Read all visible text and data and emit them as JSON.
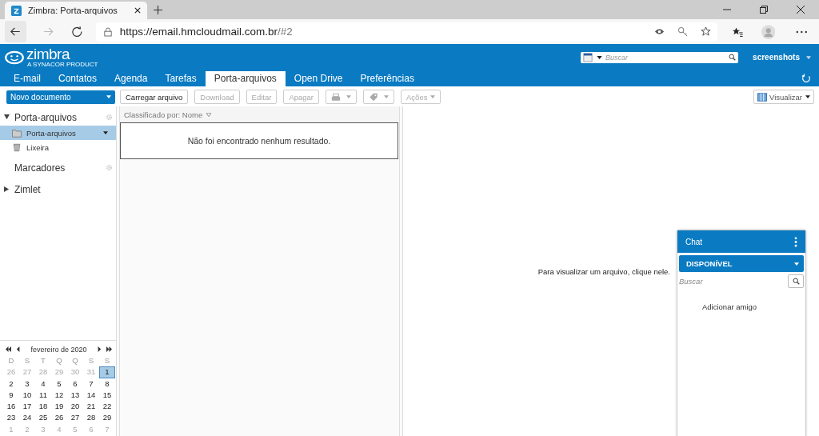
{
  "browser": {
    "tab_title": "Zimbra: Porta-arquivos",
    "url_host": "https://email.hmcloudmail.com.br",
    "url_path": "/#2"
  },
  "header": {
    "logo": "zimbra",
    "logo_tagline": "A SYNACOR PRODUCT",
    "search_placeholder": "Buscar",
    "user": "screenshots"
  },
  "nav_tabs": [
    {
      "label": "E-mail",
      "selected": false
    },
    {
      "label": "Contatos",
      "selected": false
    },
    {
      "label": "Agenda",
      "selected": false
    },
    {
      "label": "Tarefas",
      "selected": false
    },
    {
      "label": "Porta-arquivos",
      "selected": true
    },
    {
      "label": "Open Drive",
      "selected": false
    },
    {
      "label": "Preferências",
      "selected": false
    }
  ],
  "toolbar": {
    "new_button": "Novo documento",
    "items": [
      {
        "kind": "text",
        "label": "Carregar arquivo",
        "disabled": false
      },
      {
        "kind": "text",
        "label": "Download",
        "disabled": true
      },
      {
        "kind": "text",
        "label": "Editar",
        "disabled": true
      },
      {
        "kind": "text",
        "label": "Apagar",
        "disabled": true
      },
      {
        "kind": "printer",
        "disabled": true
      },
      {
        "kind": "tag",
        "disabled": true
      },
      {
        "kind": "menu",
        "label": "Ações",
        "disabled": true
      }
    ],
    "view_button": "Visualizar"
  },
  "sidebar": {
    "sections": [
      {
        "label": "Porta-arquivos",
        "kind": "tree",
        "expanded": true,
        "children": [
          {
            "label": "Porta-arquivos",
            "kind": "folder",
            "selected": true
          },
          {
            "label": "Lixeira",
            "kind": "trash",
            "selected": false
          }
        ]
      },
      {
        "label": "Marcadores",
        "kind": "plain"
      },
      {
        "label": "Zimlet",
        "kind": "tree",
        "expanded": false
      }
    ]
  },
  "file_list": {
    "sort_label": "Classificado por: Nome",
    "empty_message": "Não foi encontrado nenhum resultado."
  },
  "preview": {
    "hint": "Para visualizar um arquivo, clique nele."
  },
  "calendar": {
    "month": "fevereiro de 2020",
    "weekdays": [
      "D",
      "S",
      "T",
      "Q",
      "Q",
      "S",
      "S"
    ],
    "weeks": [
      [
        {
          "day": "26",
          "other_month": true,
          "selected": false
        },
        {
          "day": "27",
          "other_month": true,
          "selected": false
        },
        {
          "day": "28",
          "other_month": true,
          "selected": false
        },
        {
          "day": "29",
          "other_month": true,
          "selected": false
        },
        {
          "day": "30",
          "other_month": true,
          "selected": false
        },
        {
          "day": "31",
          "other_month": true,
          "selected": false
        },
        {
          "day": "1",
          "other_month": false,
          "selected": true
        }
      ],
      [
        {
          "day": "2",
          "other_month": false,
          "selected": false
        },
        {
          "day": "3",
          "other_month": false,
          "selected": false
        },
        {
          "day": "4",
          "other_month": false,
          "selected": false
        },
        {
          "day": "5",
          "other_month": false,
          "selected": false
        },
        {
          "day": "6",
          "other_month": false,
          "selected": false
        },
        {
          "day": "7",
          "other_month": false,
          "selected": false
        },
        {
          "day": "8",
          "other_month": false,
          "selected": false
        }
      ],
      [
        {
          "day": "9",
          "other_month": false,
          "selected": false
        },
        {
          "day": "10",
          "other_month": false,
          "selected": false
        },
        {
          "day": "11",
          "other_month": false,
          "selected": false
        },
        {
          "day": "12",
          "other_month": false,
          "selected": false
        },
        {
          "day": "13",
          "other_month": false,
          "selected": false
        },
        {
          "day": "14",
          "other_month": false,
          "selected": false
        },
        {
          "day": "15",
          "other_month": false,
          "selected": false
        }
      ],
      [
        {
          "day": "16",
          "other_month": false,
          "selected": false
        },
        {
          "day": "17",
          "other_month": false,
          "selected": false
        },
        {
          "day": "18",
          "other_month": false,
          "selected": false
        },
        {
          "day": "19",
          "other_month": false,
          "selected": false
        },
        {
          "day": "20",
          "other_month": false,
          "selected": false
        },
        {
          "day": "21",
          "other_month": false,
          "selected": false
        },
        {
          "day": "22",
          "other_month": false,
          "selected": false
        }
      ],
      [
        {
          "day": "23",
          "other_month": false,
          "selected": false
        },
        {
          "day": "24",
          "other_month": false,
          "selected": false
        },
        {
          "day": "25",
          "other_month": false,
          "selected": false
        },
        {
          "day": "26",
          "other_month": false,
          "selected": false
        },
        {
          "day": "27",
          "other_month": false,
          "selected": false
        },
        {
          "day": "28",
          "other_month": false,
          "selected": false
        },
        {
          "day": "29",
          "other_month": false,
          "selected": false
        }
      ],
      [
        {
          "day": "1",
          "other_month": true,
          "selected": false
        },
        {
          "day": "2",
          "other_month": true,
          "selected": false
        },
        {
          "day": "3",
          "other_month": true,
          "selected": false
        },
        {
          "day": "4",
          "other_month": true,
          "selected": false
        },
        {
          "day": "5",
          "other_month": true,
          "selected": false
        },
        {
          "day": "6",
          "other_month": true,
          "selected": false
        },
        {
          "day": "7",
          "other_month": true,
          "selected": false
        }
      ]
    ]
  },
  "chat": {
    "title": "Chat",
    "status": "DISPONÍVEL",
    "search_placeholder": "Buscar",
    "add_contact": "Adicionar amigo"
  }
}
